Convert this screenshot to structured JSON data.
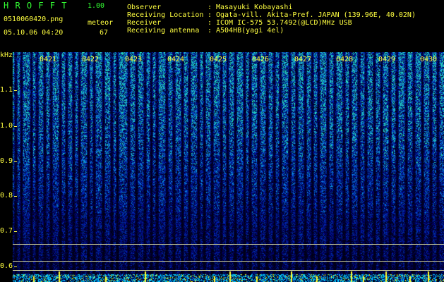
{
  "app": {
    "name": "H R O F F T",
    "version": "1.00"
  },
  "file": {
    "name": "0510060420.png",
    "timestamp": "05.10.06 04:20"
  },
  "counter": {
    "label": "meteor",
    "value": "67"
  },
  "info": {
    "observer_label": "Observer",
    "observer_value": "Masayuki Kobayashi",
    "location_label": "Receiving Location",
    "location_value": "Ogata-vill. Akita-Pref. JAPAN (139.96E, 40.02N)",
    "receiver_label": "Receiver",
    "receiver_value": "ICOM IC-575 53.7492(@LCD)MHz USB",
    "antenna_label": "Receiving antenna",
    "antenna_value": "A504HB(yagi 4el)",
    "separator": ":"
  },
  "yaxis": {
    "unit": "kHz",
    "ticks": [
      "1.1",
      "1.0",
      "0.9",
      "0.8",
      "0.7",
      "0.6"
    ]
  },
  "xaxis": {
    "ticks": [
      "0421",
      "0422",
      "0423",
      "0424",
      "0425",
      "0426",
      "0427",
      "0428",
      "0429",
      "0430"
    ]
  },
  "colors": {
    "label": "#ffff40",
    "title": "#33ff33",
    "background": "#000000"
  }
}
